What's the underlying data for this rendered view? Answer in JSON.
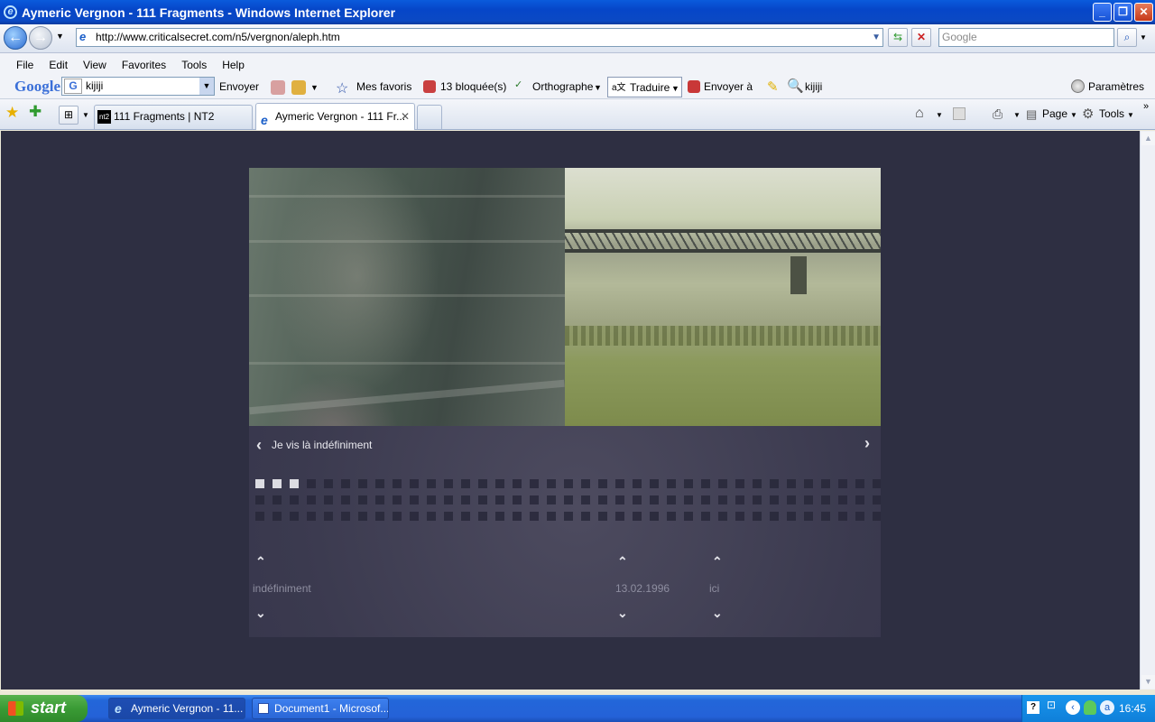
{
  "window": {
    "title": "Aymeric Vergnon - 111 Fragments - Windows Internet Explorer"
  },
  "address": {
    "url": "http://www.criticalsecret.com/n5/vergnon/aleph.htm",
    "search_placeholder": "Google"
  },
  "menu": [
    "File",
    "Edit",
    "View",
    "Favorites",
    "Tools",
    "Help"
  ],
  "google_toolbar": {
    "logo": "Google",
    "search_value": "kijiji",
    "send": "Envoyer",
    "favorites": "Mes favoris",
    "blocked": "13 bloquée(s)",
    "spellcheck": "Orthographe",
    "translate": "Traduire",
    "send_to": "Envoyer à",
    "kijiji": "kijiji",
    "settings": "Paramètres"
  },
  "tabs": [
    {
      "label": "111 Fragments | NT2",
      "active": false
    },
    {
      "label": "Aymeric Vergnon - 111 Fr...",
      "active": true
    }
  ],
  "command_bar": {
    "page": "Page",
    "tools": "Tools"
  },
  "page": {
    "caption": "Je vis là indéfiniment",
    "selectors": [
      {
        "value": "indéfiniment"
      },
      {
        "value": "13.02.1996"
      },
      {
        "value": "ici"
      }
    ],
    "progress": {
      "total": 111,
      "visited": 3
    }
  },
  "taskbar": {
    "start": "start",
    "items": [
      "Aymeric Vergnon - 11...",
      "Document1 - Microsof..."
    ],
    "clock": "16:45"
  }
}
